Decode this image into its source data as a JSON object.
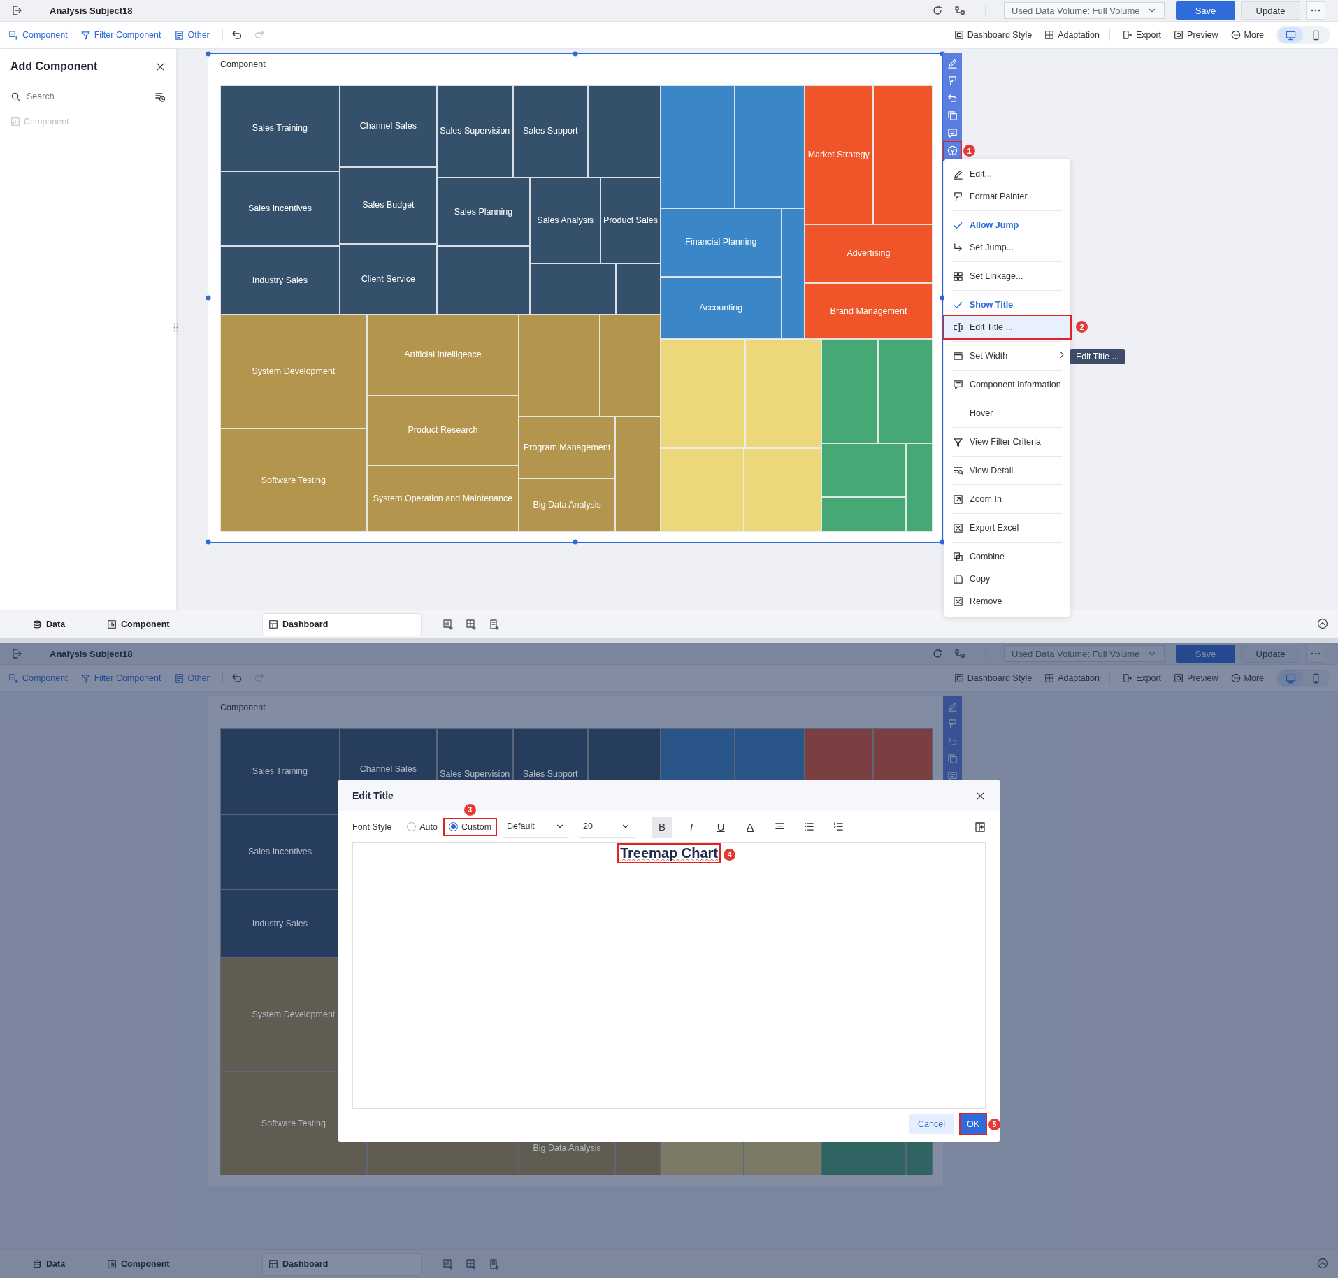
{
  "screens": [
    {
      "header": {
        "title": "Analysis Subject18",
        "data_volume": "Used Data Volume: Full Volume",
        "save": "Save",
        "update": "Update"
      },
      "toolbar": {
        "left": [
          {
            "label": "Component"
          },
          {
            "label": "Filter Component"
          },
          {
            "label": "Other"
          }
        ],
        "right": [
          {
            "label": "Dashboard Style"
          },
          {
            "label": "Adaptation"
          },
          {
            "label": "Export"
          },
          {
            "label": "Preview"
          },
          {
            "label": "More"
          }
        ],
        "devices": [
          {
            "selected": true
          },
          {
            "selected": false
          }
        ]
      },
      "side_panel": {
        "title": "Add Component",
        "search": {
          "placeholder": "Search"
        },
        "items": [
          {
            "label": "Component",
            "disabled": true
          }
        ]
      },
      "component": {
        "title": "Component",
        "selected": true,
        "treemap": {
          "groups": [
            {
              "color": "#34506a",
              "tiles": [
                {
                  "kind": "label",
                  "label": "Sales Training"
                },
                {
                  "kind": "label",
                  "label": "Sales Incentives"
                },
                {
                  "kind": "label",
                  "label": "Industry Sales"
                },
                {
                  "kind": "label",
                  "label": "Channel Sales"
                },
                {
                  "kind": "label",
                  "label": "Sales Budget"
                },
                {
                  "kind": "label",
                  "label": "Client Service"
                },
                {
                  "kind": "label",
                  "label": "Sales Supervision"
                },
                {
                  "kind": "label",
                  "label": "Sales Support"
                },
                {
                  "kind": "blank"
                },
                {
                  "kind": "label",
                  "label": "Sales Planning"
                },
                {
                  "kind": "label",
                  "label": "Sales Analysis"
                },
                {
                  "kind": "label",
                  "label": "Product Sales"
                },
                {
                  "kind": "blank"
                },
                {
                  "kind": "blank"
                },
                {
                  "kind": "blank"
                }
              ]
            },
            {
              "color": "#b3954e",
              "tiles": [
                {
                  "kind": "label",
                  "label": "System Development"
                },
                {
                  "kind": "label",
                  "label": "Software Testing"
                },
                {
                  "kind": "label",
                  "label": "Artificial Intelligence"
                },
                {
                  "kind": "label",
                  "label": "Product Research"
                },
                {
                  "kind": "label",
                  "label": "System Operation and Maintenance"
                },
                {
                  "kind": "label",
                  "label": "Program Management"
                },
                {
                  "kind": "label",
                  "label": "Big Data Analysis"
                },
                {
                  "kind": "blank"
                },
                {
                  "kind": "blank"
                },
                {
                  "kind": "blank"
                }
              ]
            },
            {
              "color": "#3a86c6",
              "tiles": [
                {
                  "kind": "label",
                  "label": "Financial Planning"
                },
                {
                  "kind": "label",
                  "label": "Accounting"
                },
                {
                  "kind": "blank"
                },
                {
                  "kind": "blank"
                },
                {
                  "kind": "blank"
                }
              ]
            },
            {
              "color": "#ef5528",
              "tiles": [
                {
                  "kind": "label",
                  "label": "Market Strategy"
                },
                {
                  "kind": "label",
                  "label": "Advertising"
                },
                {
                  "kind": "label",
                  "label": "Brand Management"
                },
                {
                  "kind": "blank"
                }
              ]
            },
            {
              "color": "#ecd87a",
              "tiles": [
                {
                  "kind": "blank"
                },
                {
                  "kind": "blank"
                },
                {
                  "kind": "blank"
                },
                {
                  "kind": "blank"
                }
              ]
            },
            {
              "color": "#46a874",
              "tiles": [
                {
                  "kind": "blank"
                },
                {
                  "kind": "blank"
                },
                {
                  "kind": "blank"
                },
                {
                  "kind": "blank"
                },
                {
                  "kind": "blank"
                }
              ]
            }
          ]
        }
      },
      "side_tools": [
        {
          "highlighted": false
        },
        {
          "highlighted": false
        },
        {
          "highlighted": false
        },
        {
          "highlighted": false
        },
        {
          "highlighted": false
        },
        {
          "highlighted": true,
          "callout": "1"
        }
      ],
      "context_menu": {
        "groups": [
          {
            "items": [
              {
                "kind": "action",
                "label": "Edit..."
              },
              {
                "kind": "action",
                "label": "Format Painter"
              }
            ]
          },
          {
            "items": [
              {
                "kind": "check",
                "label": "Allow Jump",
                "checked": true
              },
              {
                "kind": "action",
                "label": "Set Jump..."
              }
            ]
          },
          {
            "items": [
              {
                "kind": "action",
                "label": "Set Linkage..."
              }
            ]
          },
          {
            "items": [
              {
                "kind": "check",
                "label": "Show Title",
                "checked": true
              },
              {
                "kind": "action",
                "label": "Edit Title ...",
                "highlighted": true,
                "callout": "2"
              }
            ]
          },
          {
            "items": [
              {
                "kind": "submenu",
                "label": "Set Width"
              }
            ]
          },
          {
            "items": [
              {
                "kind": "action",
                "label": "Component Information"
              }
            ]
          },
          {
            "items": [
              {
                "kind": "action",
                "label": "Hover"
              }
            ]
          },
          {
            "items": [
              {
                "kind": "action",
                "label": "View Filter Criteria"
              }
            ]
          },
          {
            "items": [
              {
                "kind": "action",
                "label": "View Detail"
              }
            ]
          },
          {
            "items": [
              {
                "kind": "action",
                "label": "Zoom In"
              }
            ]
          },
          {
            "items": [
              {
                "kind": "action",
                "label": "Export Excel"
              }
            ]
          },
          {
            "items": [
              {
                "kind": "action",
                "label": "Combine"
              },
              {
                "kind": "action",
                "label": "Copy"
              },
              {
                "kind": "action",
                "label": "Remove"
              }
            ]
          }
        ]
      },
      "tooltip": "Edit Title ...",
      "bottom_tabs": [
        {
          "label": "Data",
          "selected": false
        },
        {
          "label": "Component",
          "selected": false
        },
        {
          "label": "Dashboard",
          "selected": true
        }
      ]
    },
    {
      "header": {
        "title": "Analysis Subject18",
        "data_volume": "Used Data Volume: Full Volume",
        "save": "Save",
        "update": "Update"
      },
      "toolbar": {
        "left": [
          {
            "label": "Component"
          },
          {
            "label": "Filter Component"
          },
          {
            "label": "Other"
          }
        ],
        "right": [
          {
            "label": "Dashboard Style"
          },
          {
            "label": "Adaptation"
          },
          {
            "label": "Export"
          },
          {
            "label": "Preview"
          },
          {
            "label": "More"
          }
        ],
        "devices": [
          {
            "selected": true
          },
          {
            "selected": false
          }
        ]
      },
      "component": {
        "title": "Component",
        "selected": false,
        "treemap": {
          "groups": [
            {
              "color": "#273d5e",
              "tiles": [
                {
                  "kind": "label",
                  "label": "Sales Training"
                },
                {
                  "kind": "label",
                  "label": "Sales Incentives"
                },
                {
                  "kind": "label",
                  "label": "Industry Sales"
                },
                {
                  "kind": "label",
                  "label": "Channel Sales"
                },
                {
                  "kind": "label",
                  "label": "Sales Supervision"
                },
                {
                  "kind": "label",
                  "label": "Sales Support"
                },
                {
                  "kind": "blank"
                }
              ]
            },
            {
              "color": "#605c52",
              "tiles": [
                {
                  "kind": "label",
                  "label": "System Development"
                },
                {
                  "kind": "label",
                  "label": "Software Testing"
                },
                {
                  "kind": "blank"
                },
                {
                  "kind": "label",
                  "label": "Big Data Analysis"
                },
                {
                  "kind": "blank"
                }
              ]
            },
            {
              "color": "#2a5588",
              "tiles": [
                {
                  "kind": "blank"
                },
                {
                  "kind": "blank"
                }
              ]
            },
            {
              "color": "#7b3f41",
              "tiles": [
                {
                  "kind": "blank"
                },
                {
                  "kind": "blank"
                }
              ]
            },
            {
              "color": "#7a7a66",
              "tiles": [
                {
                  "kind": "blank"
                },
                {
                  "kind": "blank"
                }
              ]
            },
            {
              "color": "#2f6463",
              "tiles": [
                {
                  "kind": "blank"
                },
                {
                  "kind": "blank"
                }
              ]
            }
          ]
        }
      },
      "side_tools": [
        {
          "highlighted": false
        },
        {
          "highlighted": false
        },
        {
          "highlighted": false
        },
        {
          "highlighted": false
        },
        {
          "highlighted": false
        }
      ],
      "bottom_tabs": [
        {
          "label": "Data",
          "selected": false
        },
        {
          "label": "Component",
          "selected": false
        },
        {
          "label": "Dashboard",
          "selected": true
        }
      ],
      "dialog": {
        "title": "Edit Title",
        "font_style_label": "Font Style",
        "radios": [
          {
            "label": "Auto",
            "selected": false
          },
          {
            "label": "Custom",
            "selected": true,
            "callout": "3"
          }
        ],
        "font": "Default",
        "size": "20",
        "format_buttons": [
          {
            "label": "B",
            "selected": true
          },
          {
            "label": "I",
            "selected": false
          },
          {
            "label": "U",
            "selected": false
          },
          {
            "label": "A",
            "selected": false
          }
        ],
        "content": {
          "text": "Treemap Chart",
          "callout": "4"
        },
        "cancel": "Cancel",
        "ok": {
          "label": "OK",
          "callout": "5"
        }
      }
    }
  ]
}
